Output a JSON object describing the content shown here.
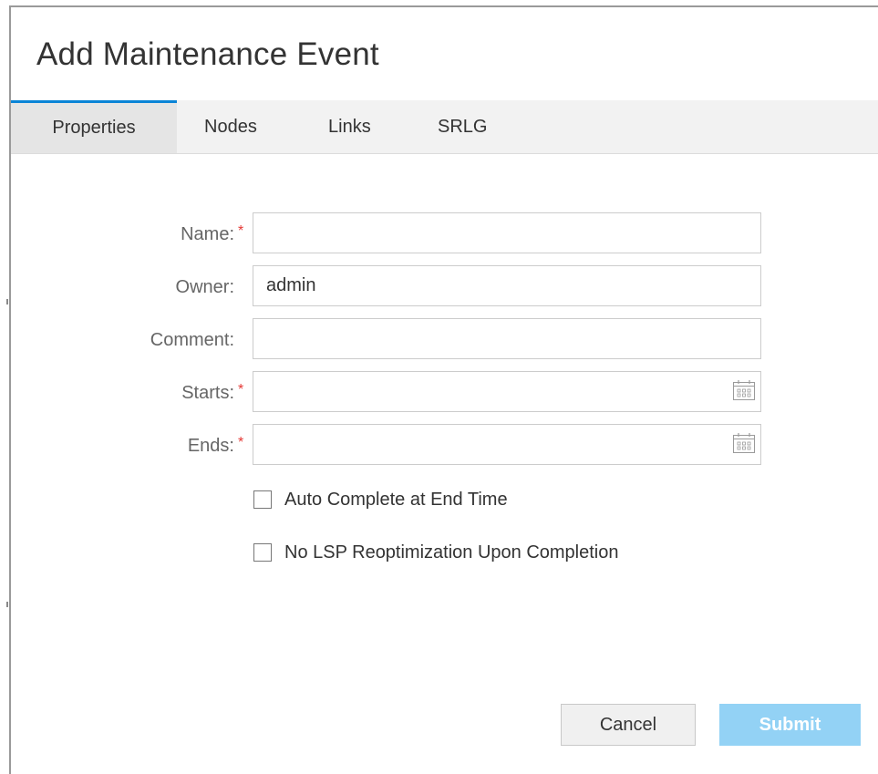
{
  "dialog": {
    "title": "Add Maintenance Event"
  },
  "tabs": [
    {
      "label": "Properties",
      "active": true
    },
    {
      "label": "Nodes",
      "active": false
    },
    {
      "label": "Links",
      "active": false
    },
    {
      "label": "SRLG",
      "active": false
    }
  ],
  "form": {
    "name": {
      "label": "Name:",
      "required_mark": "*",
      "value": ""
    },
    "owner": {
      "label": "Owner:",
      "value": "admin"
    },
    "comment": {
      "label": "Comment:",
      "value": ""
    },
    "starts": {
      "label": "Starts:",
      "required_mark": "*",
      "value": "",
      "icon": "calendar-icon"
    },
    "ends": {
      "label": "Ends:",
      "required_mark": "*",
      "value": "",
      "icon": "calendar-icon"
    }
  },
  "options": {
    "auto_complete": {
      "label": "Auto Complete at End Time",
      "checked": false
    },
    "no_lsp_reopt": {
      "label": "No LSP Reoptimization Upon Completion",
      "checked": false
    }
  },
  "buttons": {
    "cancel": "Cancel",
    "submit": "Submit"
  },
  "colors": {
    "accent": "#0a84d6",
    "required": "#e53935",
    "submit_disabled": "#93d2f5"
  }
}
